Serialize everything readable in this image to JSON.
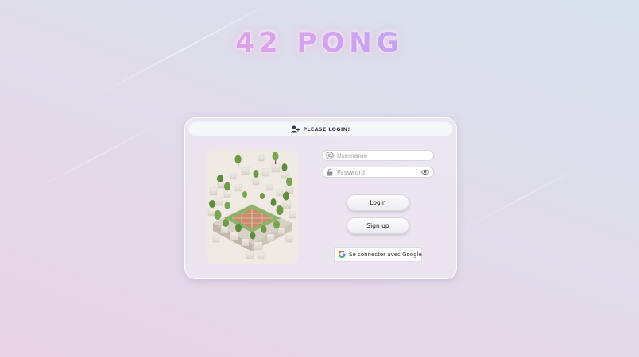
{
  "app": {
    "title": "42 PONG"
  },
  "login_card": {
    "header": {
      "icon": "user-plus-icon",
      "label": "PLEASE LOGIN!"
    },
    "preview_image": "isometric-voxel-tennis-court-with-trees",
    "username": {
      "icon": "at-sign-icon",
      "placeholder": "Username",
      "value": ""
    },
    "password": {
      "icon": "lock-icon",
      "placeholder": "Password",
      "value": "",
      "toggle_icon": "eye-icon"
    },
    "login_button": "Login",
    "signup_button": "Sign up",
    "google_button": {
      "icon": "google-g-icon",
      "label": "Se connecter avec Google"
    }
  },
  "colors": {
    "title_gradient": [
      "#f29ac2",
      "#d9a3ee",
      "#b7a6f3",
      "#8fc7ee"
    ],
    "card_background": "#eee8f2",
    "court_clay": "#c98b6a",
    "court_grass": "#8fb36a"
  }
}
